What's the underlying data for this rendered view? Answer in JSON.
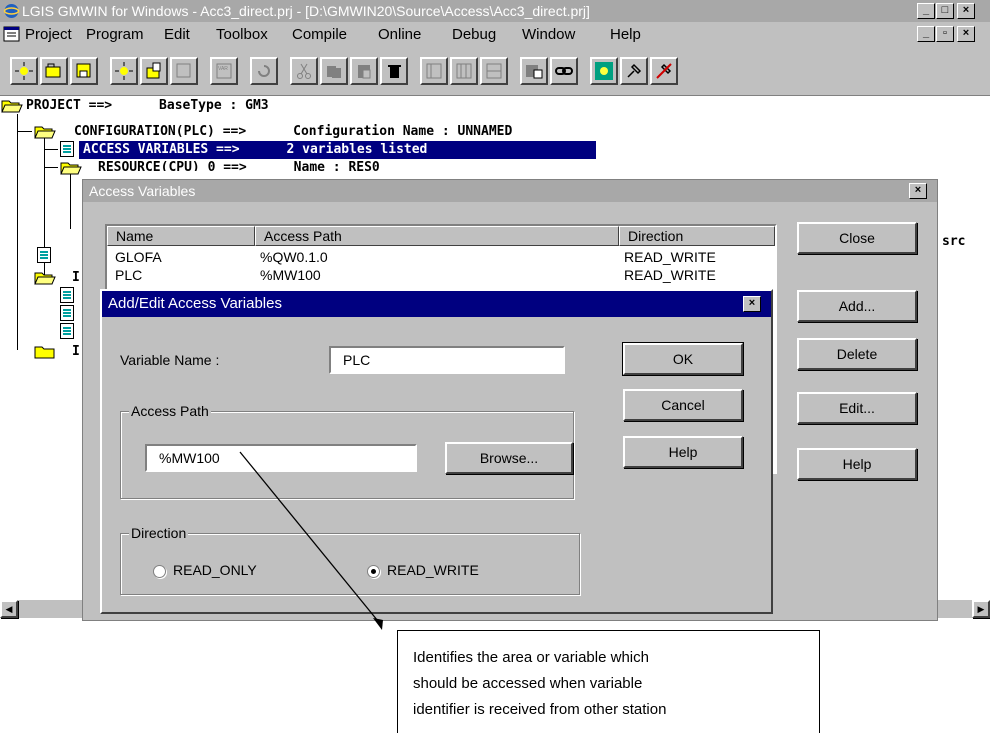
{
  "window": {
    "title": "LGIS GMWIN for Windows - Acc3_direct.prj - [D:\\GMWIN20\\Source\\Access\\Acc3_direct.prj]"
  },
  "menubar": {
    "items": [
      "Project",
      "Program",
      "Edit",
      "Toolbox",
      "Compile",
      "Online",
      "Debug",
      "Window",
      "Help"
    ]
  },
  "tree": {
    "rows": [
      "PROJECT ==>      BaseType : GM3",
      "CONFIGURATION(PLC) ==>      Configuration Name : UNNAMED",
      "ACCESS VARIABLES ==>      2 variables listed",
      "RESOURCE(CPU) 0 ==>      Name : RES0"
    ],
    "partial_right": "src",
    "partial_left": [
      "I",
      "I"
    ]
  },
  "access_dialog": {
    "title": "Access Variables",
    "columns": [
      "Name",
      "Access Path",
      "Direction"
    ],
    "rows": [
      {
        "name": "GLOFA",
        "path": "%QW0.1.0",
        "direction": "READ_WRITE"
      },
      {
        "name": "PLC",
        "path": "%MW100",
        "direction": "READ_WRITE"
      }
    ],
    "buttons": {
      "close": "Close",
      "add": "Add...",
      "delete": "Delete",
      "edit": "Edit...",
      "help": "Help"
    }
  },
  "edit_dialog": {
    "title": "Add/Edit Access Variables",
    "variable_name_label": "Variable Name :",
    "variable_name_value": "PLC",
    "access_path_group": "Access Path",
    "access_path_value": "%MW100",
    "browse_label": "Browse...",
    "direction_group": "Direction",
    "direction_options": [
      "READ_ONLY",
      "READ_WRITE"
    ],
    "direction_selected": "READ_WRITE",
    "ok_label": "OK",
    "cancel_label": "Cancel",
    "help_label": "Help"
  },
  "callout": {
    "lines": [
      "Identifies the area or variable which",
      "should be accessed when variable",
      "identifier is received from other station"
    ]
  },
  "colors": {
    "active_title": "#000080",
    "inactive_title": "#a8a8a8",
    "face": "#c0c0c0",
    "selection": "#000080"
  }
}
